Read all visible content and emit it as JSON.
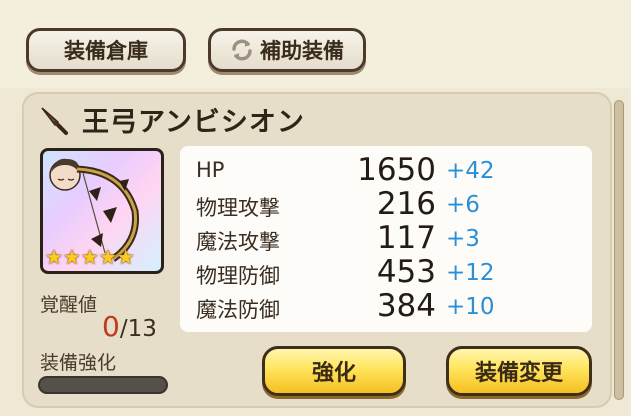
{
  "top_buttons": {
    "storage_label": "装備倉庫",
    "sub_equip_label": "補助装備"
  },
  "weapon": {
    "name": "王弓アンビシオン",
    "rarity_stars": 5,
    "star_glyph": "★"
  },
  "stats": [
    {
      "name": "HP",
      "value": "1650",
      "bonus": "+42"
    },
    {
      "name": "物理攻撃",
      "value": "216",
      "bonus": "+6"
    },
    {
      "name": "魔法攻撃",
      "value": "117",
      "bonus": "+3"
    },
    {
      "name": "物理防御",
      "value": "453",
      "bonus": "+12"
    },
    {
      "name": "魔法防御",
      "value": "384",
      "bonus": "+10"
    }
  ],
  "awakening": {
    "label": "覚醒値",
    "current": "0",
    "max": "/13"
  },
  "enhancement": {
    "label": "装備強化",
    "progress": 0
  },
  "action_buttons": {
    "enhance_label": "強化",
    "change_label": "装備変更"
  },
  "colors": {
    "bonus": "#2a8fd8",
    "awaken_current": "#c03a1c",
    "action_button": "#ffe45c"
  },
  "icons": [
    "refresh-icon",
    "sword-icon",
    "star-icon"
  ]
}
